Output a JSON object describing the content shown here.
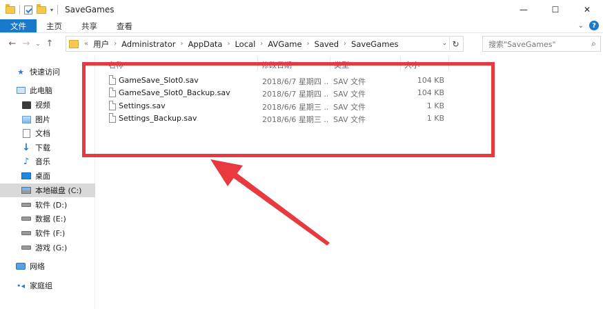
{
  "window": {
    "title": "SaveGames",
    "controls": {
      "minimize": "—",
      "maximize": "☐",
      "close": "✕"
    }
  },
  "ribbon": {
    "tabs": [
      "文件",
      "主页",
      "共享",
      "查看"
    ]
  },
  "address": {
    "prefix": "«",
    "crumbs": [
      "用户",
      "Administrator",
      "AppData",
      "Local",
      "AVGame",
      "Saved",
      "SaveGames"
    ],
    "search_placeholder": "搜索\"SaveGames\""
  },
  "sidebar": {
    "items": [
      {
        "label": "快速访问",
        "icon": "star-icon"
      },
      {
        "label": "此电脑",
        "icon": "pc-icon"
      },
      {
        "label": "视频",
        "icon": "video-icon"
      },
      {
        "label": "图片",
        "icon": "pictures-icon"
      },
      {
        "label": "文档",
        "icon": "documents-icon"
      },
      {
        "label": "下载",
        "icon": "download-icon"
      },
      {
        "label": "音乐",
        "icon": "music-icon"
      },
      {
        "label": "桌面",
        "icon": "desktop-icon"
      },
      {
        "label": "本地磁盘 (C:)",
        "icon": "drive-c-icon",
        "selected": true
      },
      {
        "label": "软件 (D:)",
        "icon": "drive-icon"
      },
      {
        "label": "数据 (E:)",
        "icon": "drive-icon"
      },
      {
        "label": "软件 (F:)",
        "icon": "drive-icon"
      },
      {
        "label": "游戏 (G:)",
        "icon": "drive-icon"
      },
      {
        "label": "网络",
        "icon": "network-icon"
      },
      {
        "label": "家庭组",
        "icon": "homegroup-icon"
      }
    ]
  },
  "columns": {
    "name": "名称",
    "date": "修改日期",
    "type": "类型",
    "size": "大小"
  },
  "files": [
    {
      "name": "GameSave_Slot0.sav",
      "date": "2018/6/7 星期四 ...",
      "type": "SAV 文件",
      "size": "104 KB"
    },
    {
      "name": "GameSave_Slot0_Backup.sav",
      "date": "2018/6/7 星期四 ...",
      "type": "SAV 文件",
      "size": "104 KB"
    },
    {
      "name": "Settings.sav",
      "date": "2018/6/6 星期三 ...",
      "type": "SAV 文件",
      "size": "1 KB"
    },
    {
      "name": "Settings_Backup.sav",
      "date": "2018/6/6 星期三 ...",
      "type": "SAV 文件",
      "size": "1 KB"
    }
  ],
  "colors": {
    "file_tab": "#1979ca",
    "annotation_red": "#e8393f",
    "selected_bg": "#d9d9d9"
  }
}
